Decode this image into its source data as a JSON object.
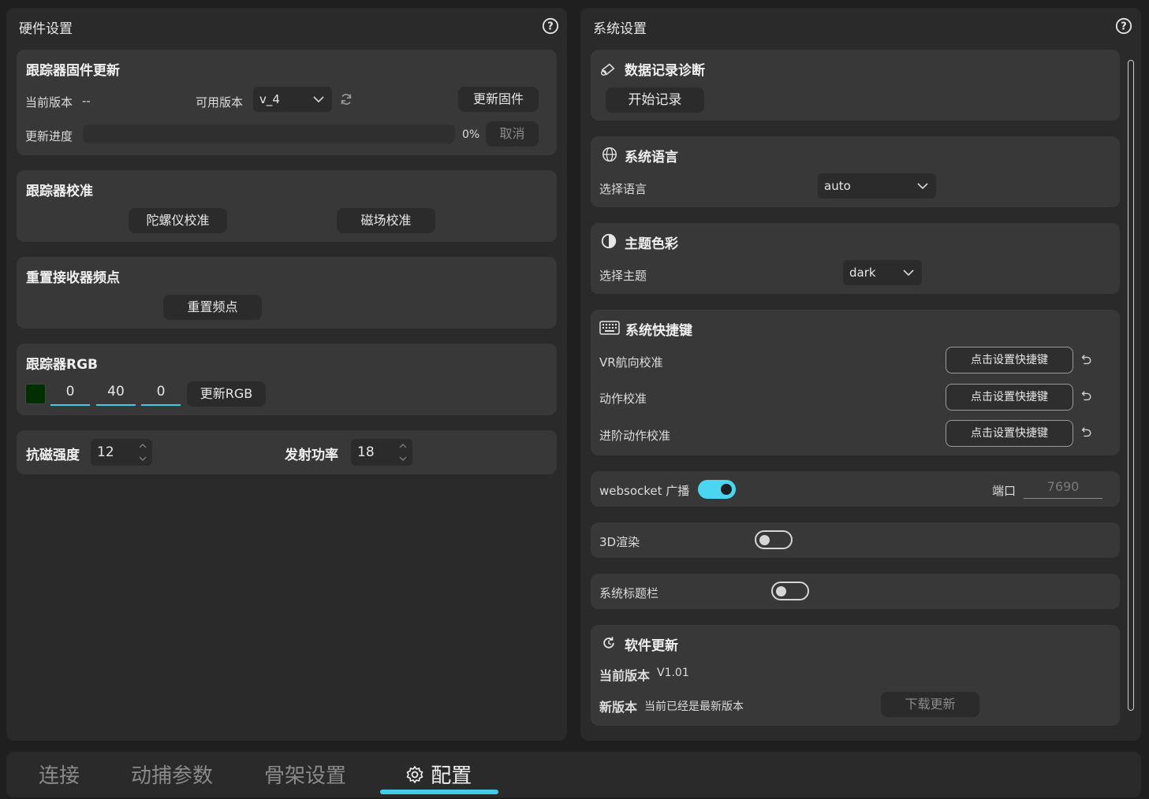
{
  "hardware": {
    "title": "硬件设置",
    "firmware": {
      "title": "跟踪器固件更新",
      "current_version_label": "当前版本",
      "current_version_value": "--",
      "available_version_label": "可用版本",
      "available_version_value": "v_4",
      "update_button": "更新固件",
      "progress_label": "更新进度",
      "progress_value": 0,
      "progress_text": "0%",
      "cancel_button": "取消"
    },
    "calibration": {
      "title": "跟踪器校准",
      "gyro_button": "陀螺仪校准",
      "mag_button": "磁场校准"
    },
    "reset_freq": {
      "title": "重置接收器频点",
      "button": "重置频点"
    },
    "rgb": {
      "title": "跟踪器RGB",
      "swatch_color": "#003000",
      "r": "0",
      "g": "40",
      "b": "0",
      "button": "更新RGB"
    },
    "power": {
      "anti_mag_label": "抗磁强度",
      "anti_mag_value": "12",
      "tx_power_label": "发射功率",
      "tx_power_value": "18"
    }
  },
  "system": {
    "title": "系统设置",
    "log": {
      "title": "数据记录诊断",
      "button": "开始记录"
    },
    "language": {
      "title": "系统语言",
      "label": "选择语言",
      "value": "auto"
    },
    "theme": {
      "title": "主题色彩",
      "label": "选择主题",
      "value": "dark"
    },
    "shortcuts": {
      "title": "系统快捷键",
      "items": [
        {
          "label": "VR航向校准",
          "button": "点击设置快捷键"
        },
        {
          "label": "动作校准",
          "button": "点击设置快捷键"
        },
        {
          "label": "进阶动作校准",
          "button": "点击设置快捷键"
        }
      ]
    },
    "websocket": {
      "label": "websocket 广播",
      "enabled": true,
      "port_label": "端口",
      "port_value": "7690"
    },
    "render3d": {
      "label": "3D渲染",
      "enabled": false
    },
    "titlebar": {
      "label": "系统标题栏",
      "enabled": false
    },
    "update": {
      "title": "软件更新",
      "current_label": "当前版本",
      "current_value": "V1.01",
      "new_label": "新版本",
      "new_value": "当前已经是最新版本",
      "button": "下载更新"
    }
  },
  "tabs": {
    "connect": "连接",
    "mocap": "动捕参数",
    "skeleton": "骨架设置",
    "config": "配置"
  },
  "colors": {
    "accent": "#3fcde8",
    "panel": "#2a2a2a",
    "card": "#383838"
  }
}
